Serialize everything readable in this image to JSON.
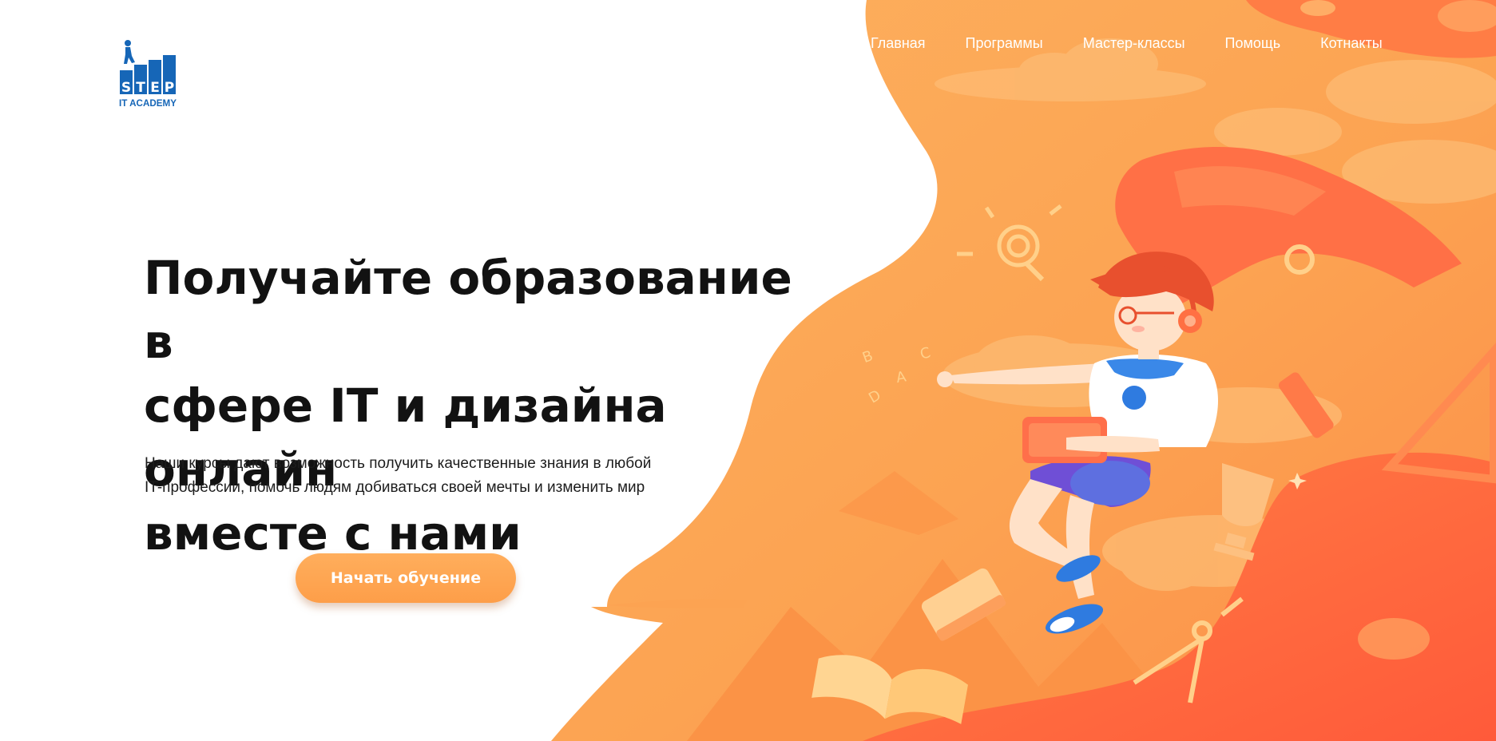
{
  "logo": {
    "word": "STEP",
    "subtitle": "IT ACADEMY"
  },
  "nav": {
    "items": [
      {
        "label": "Главная"
      },
      {
        "label": "Программы"
      },
      {
        "label": "Мастер-классы"
      },
      {
        "label": "Помощь"
      },
      {
        "label": "Котнакты"
      }
    ]
  },
  "hero": {
    "headline_line1": "Получайте образование в",
    "headline_line2": "сфере IT и дизайна онлайн",
    "headline_line3": "вместе с нами",
    "subtext_line1": "Наши курсы дают возможность получить качественные знания в любой",
    "subtext_line2": "IT-профессии, помочь людям добиваться своей мечты и изменить мир",
    "cta_label": "Начать обучение"
  },
  "illustration": {
    "floating_letters": [
      "B",
      "C",
      "A",
      "D"
    ]
  },
  "colors": {
    "accent_orange": "#fd9e49",
    "blob_orange": "#fca352",
    "deep_orange": "#ff6a3d",
    "logo_blue": "#1666b7",
    "headline": "#121212"
  }
}
